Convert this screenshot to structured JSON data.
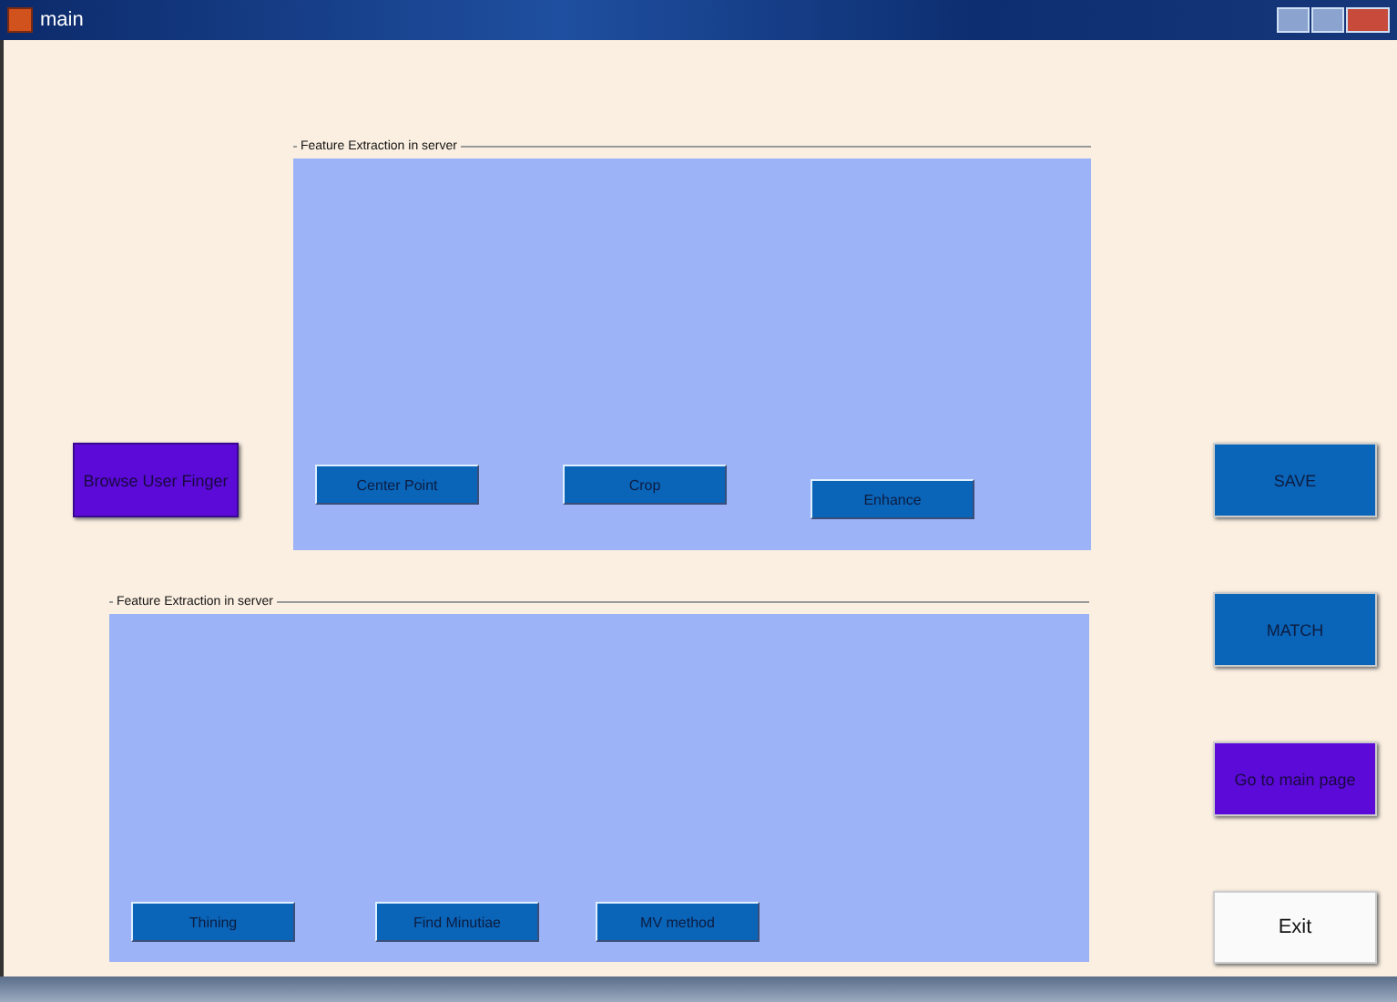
{
  "window": {
    "title": "main"
  },
  "browse_button": {
    "label": "Browse User Finger"
  },
  "panels": [
    {
      "title": "Feature Extraction in server",
      "buttons": [
        {
          "label": "Center Point"
        },
        {
          "label": "Crop"
        },
        {
          "label": "Enhance"
        }
      ]
    },
    {
      "title": "Feature Extraction in server",
      "buttons": [
        {
          "label": "Thining"
        },
        {
          "label": "Find Minutiae"
        },
        {
          "label": "MV method"
        }
      ]
    }
  ],
  "side_buttons": [
    {
      "label": "SAVE",
      "kind": "blue"
    },
    {
      "label": "MATCH",
      "kind": "blue"
    },
    {
      "label": "Go to main page",
      "kind": "purple"
    },
    {
      "label": "Exit",
      "kind": "plain"
    }
  ]
}
